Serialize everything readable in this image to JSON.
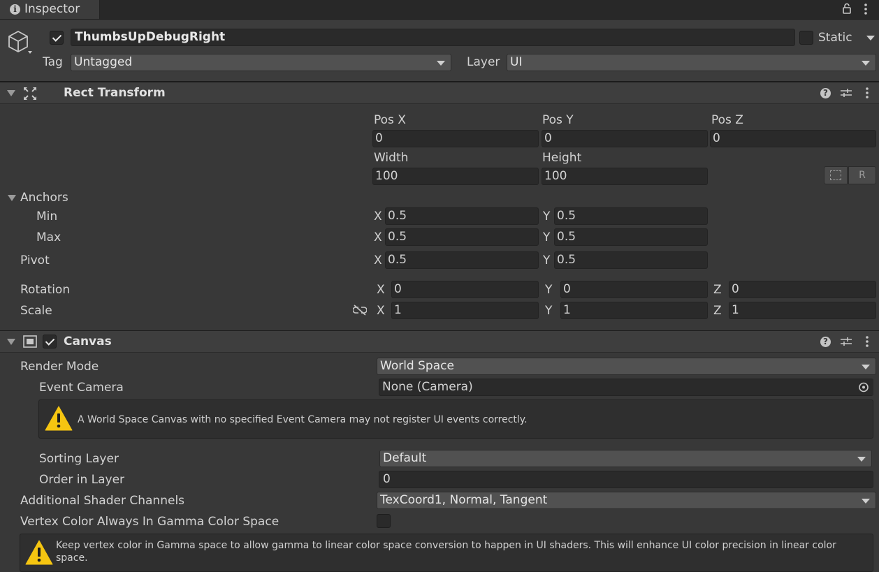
{
  "tab": {
    "title": "Inspector"
  },
  "object": {
    "name": "ThumbsUpDebugRight",
    "static_label": "Static",
    "tag_label": "Tag",
    "tag_value": "Untagged",
    "layer_label": "Layer",
    "layer_value": "UI"
  },
  "rect_transform": {
    "title": "Rect Transform",
    "pos_x_label": "Pos X",
    "pos_y_label": "Pos Y",
    "pos_z_label": "Pos Z",
    "pos_x": "0",
    "pos_y": "0",
    "pos_z": "0",
    "width_label": "Width",
    "height_label": "Height",
    "width": "100",
    "height": "100",
    "blueprint_btn": "",
    "raw_btn": "R",
    "anchors_label": "Anchors",
    "min_label": "Min",
    "max_label": "Max",
    "min_x": "0.5",
    "min_y": "0.5",
    "max_x": "0.5",
    "max_y": "0.5",
    "pivot_label": "Pivot",
    "pivot_x": "0.5",
    "pivot_y": "0.5",
    "rotation_label": "Rotation",
    "rot_x": "0",
    "rot_y": "0",
    "rot_z": "0",
    "scale_label": "Scale",
    "scale_x": "1",
    "scale_y": "1",
    "scale_z": "1",
    "x": "X",
    "y": "Y",
    "z": "Z"
  },
  "canvas": {
    "title": "Canvas",
    "render_mode_label": "Render Mode",
    "render_mode": "World Space",
    "event_camera_label": "Event Camera",
    "event_camera": "None (Camera)",
    "warning_camera": "A World Space Canvas with no specified Event Camera may not register UI events correctly.",
    "sorting_layer_label": "Sorting Layer",
    "sorting_layer": "Default",
    "order_label": "Order in Layer",
    "order": "0",
    "shader_channels_label": "Additional Shader Channels",
    "shader_channels": "TexCoord1, Normal, Tangent",
    "vertex_color_label": "Vertex Color Always In Gamma Color Space",
    "warning_gamma": "Keep vertex color in Gamma space to allow gamma to linear color space conversion to happen in UI shaders. This will enhance UI color precision in linear color space."
  },
  "colors": {
    "background": "#383838",
    "field": "#2a2a2a",
    "dropdown": "#515151",
    "warning": "#f5c511"
  }
}
